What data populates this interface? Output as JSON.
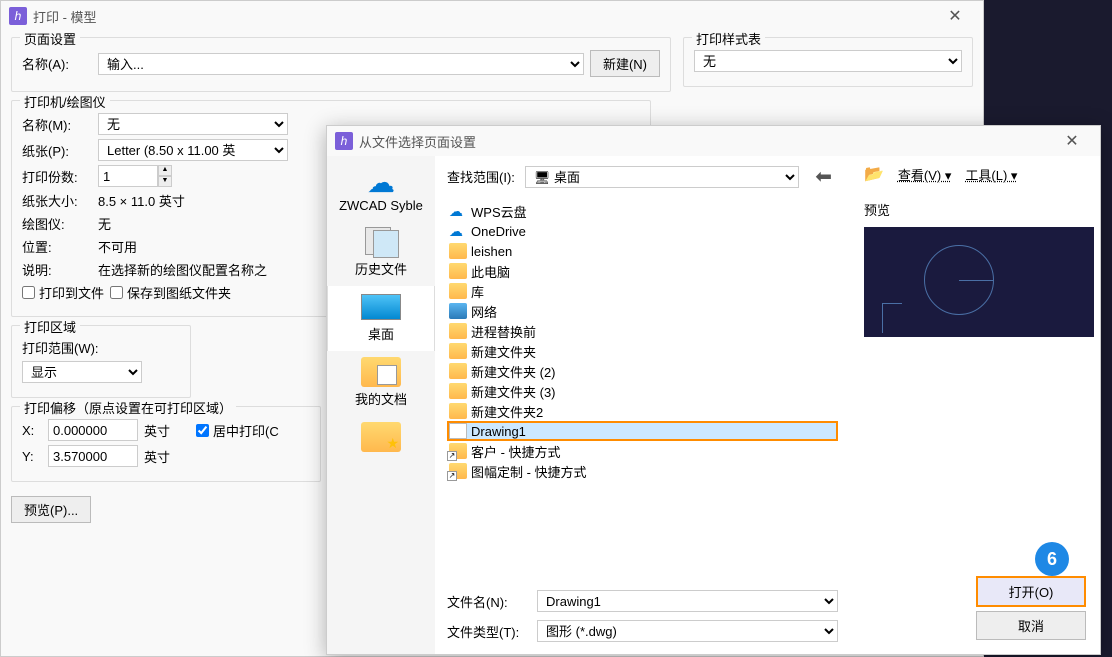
{
  "print_dialog": {
    "title": "打印 - 模型",
    "page_setup": {
      "legend": "页面设置",
      "name_label": "名称(A):",
      "name_placeholder": "输入...",
      "new_btn": "新建(N)"
    },
    "printer": {
      "legend": "打印机/绘图仪",
      "name_label": "名称(M):",
      "name_value": "无",
      "paper_label": "纸张(P):",
      "paper_value": "Letter (8.50 x 11.00 英",
      "copies_label": "打印份数:",
      "copies_value": "1",
      "size_label": "纸张大小:",
      "size_value": "8.5 × 11.0  英寸",
      "plotter_label": "绘图仪:",
      "plotter_value": "无",
      "location_label": "位置:",
      "location_value": "不可用",
      "desc_label": "说明:",
      "desc_value": "在选择新的绘图仪配置名称之",
      "to_file": "打印到文件",
      "save_folder": "保存到图纸文件夹"
    },
    "area": {
      "legend": "打印区域",
      "range_label": "打印范围(W):",
      "range_value": "显示"
    },
    "offset": {
      "legend": "打印偏移（原点设置在可打印区域）",
      "x_label": "X:",
      "x_value": "0.000000",
      "y_label": "Y:",
      "y_value": "3.570000",
      "unit": "英寸",
      "center": "居中打印(C"
    },
    "preview_btn": "预览(P)...",
    "style_table": {
      "legend": "打印样式表",
      "value": "无"
    }
  },
  "file_dialog": {
    "title": "从文件选择页面设置",
    "lookin_label": "查找范围(I):",
    "lookin_value": "桌面",
    "view_label": "查看(V)",
    "tools_label": "工具(L)",
    "sidebar": {
      "syble": "ZWCAD Syble",
      "history": "历史文件",
      "desktop": "桌面",
      "documents": "我的文档"
    },
    "items": [
      {
        "name": "WPS云盘",
        "type": "cloud"
      },
      {
        "name": "OneDrive",
        "type": "cloud"
      },
      {
        "name": "leishen",
        "type": "folder"
      },
      {
        "name": "此电脑",
        "type": "folder"
      },
      {
        "name": "库",
        "type": "folder"
      },
      {
        "name": "网络",
        "type": "folder-net"
      },
      {
        "name": "进程替换前",
        "type": "folder"
      },
      {
        "name": "新建文件夹",
        "type": "folder"
      },
      {
        "name": "新建文件夹 (2)",
        "type": "folder"
      },
      {
        "name": "新建文件夹 (3)",
        "type": "folder"
      },
      {
        "name": "新建文件夹2",
        "type": "folder"
      },
      {
        "name": "Drawing1",
        "type": "file"
      },
      {
        "name": "客户 - 快捷方式",
        "type": "shortcut"
      },
      {
        "name": "图幅定制 - 快捷方式",
        "type": "shortcut"
      }
    ],
    "preview_label": "预览",
    "filename_label": "文件名(N):",
    "filename_value": "Drawing1",
    "filetype_label": "文件类型(T):",
    "filetype_value": "图形 (*.dwg)",
    "open_btn": "打开(O)",
    "cancel_btn": "取消",
    "step_number": "6"
  }
}
